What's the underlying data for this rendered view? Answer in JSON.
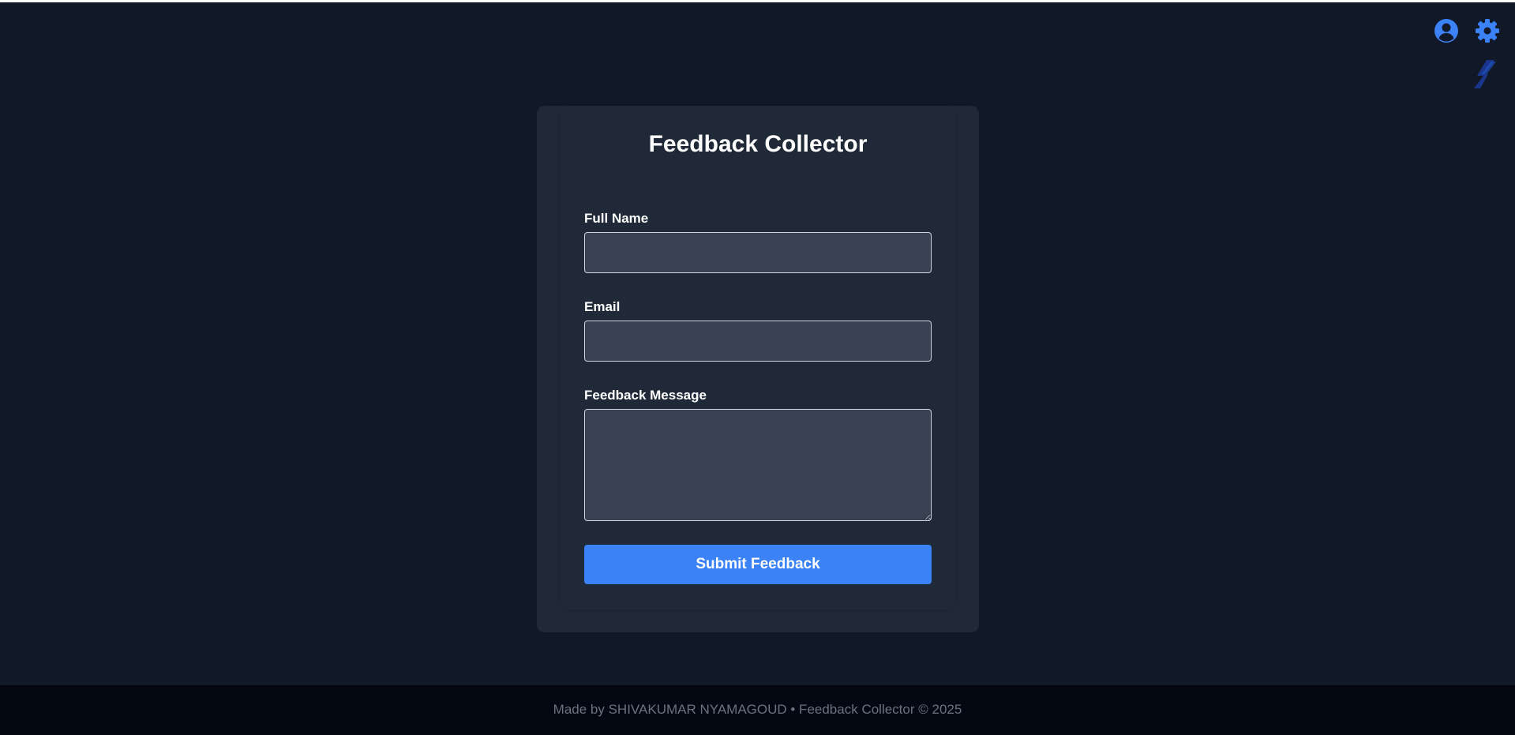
{
  "header": {
    "icons": [
      "user-circle-icon",
      "gear-icon"
    ],
    "accent_color": "#3b82f6",
    "brand_icon": "slash-logo-icon"
  },
  "form": {
    "title": "Feedback Collector",
    "fields": [
      {
        "label": "Full Name",
        "value": "",
        "placeholder": ""
      },
      {
        "label": "Email",
        "value": "",
        "placeholder": ""
      },
      {
        "label": "Feedback Message",
        "value": "",
        "placeholder": ""
      }
    ],
    "submit_label": "Submit Feedback"
  },
  "footer": {
    "text": "Made by SHIVAKUMAR NYAMAGOUD • Feedback Collector © 2025"
  },
  "colors": {
    "background": "#111827",
    "card": "#1f2937",
    "input": "#374151",
    "button": "#3b82f6",
    "footer": "#030712"
  }
}
